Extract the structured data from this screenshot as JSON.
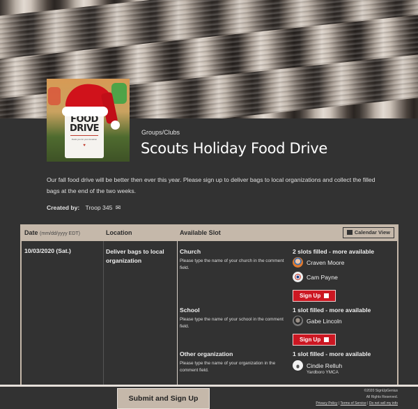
{
  "event": {
    "category": "Groups/Clubs",
    "title": "Scouts Holiday Food Drive",
    "description": "Our fall food drive will be better then ever this year.  Please sign up to deliver bags to local organizations and collect the filled bags at the end of the two weeks.",
    "created_by_label": "Created by:",
    "created_by": "Troop 345",
    "logo": {
      "line1": "FOOD",
      "line2": "DRIVE",
      "tagline": "thank you for your donation"
    }
  },
  "table": {
    "headers": {
      "date": "Date",
      "date_format": "(mm/dd/yyyy EDT)",
      "location": "Location",
      "slot": "Available Slot",
      "calendar_view": "Calendar View"
    },
    "rows": [
      {
        "date": "10/03/2020 (Sat.)",
        "location": "Deliver bags to local organization",
        "slots": [
          {
            "name": "Church",
            "note": "Please type the name of your church in the comment field.",
            "status": "2 slots filled - more available",
            "people": [
              {
                "name": "Craven Moore",
                "comment": ""
              },
              {
                "name": "Cam Payne",
                "comment": ""
              }
            ],
            "button": "Sign Up"
          },
          {
            "name": "School",
            "note": "Please type the name of your school in the comment field.",
            "status": "1 slot filled - more available",
            "people": [
              {
                "name": "Gabe Lincoln",
                "comment": ""
              }
            ],
            "button": "Sign Up"
          },
          {
            "name": "Other organization",
            "note": "Please type the name of your organization in the comment field.",
            "status": "1 slot filled - more available",
            "people": [
              {
                "name": "Cindie Relluh",
                "comment": "Yardboro YMCA"
              }
            ]
          }
        ]
      }
    ]
  },
  "submit_label": "Submit and Sign Up",
  "footer": {
    "copyright": "©2020 SignUpGenius",
    "rights": "All Rights Reserved.",
    "links": [
      "Privacy Policy",
      "Terms of Service",
      "Do not sell my info"
    ]
  }
}
